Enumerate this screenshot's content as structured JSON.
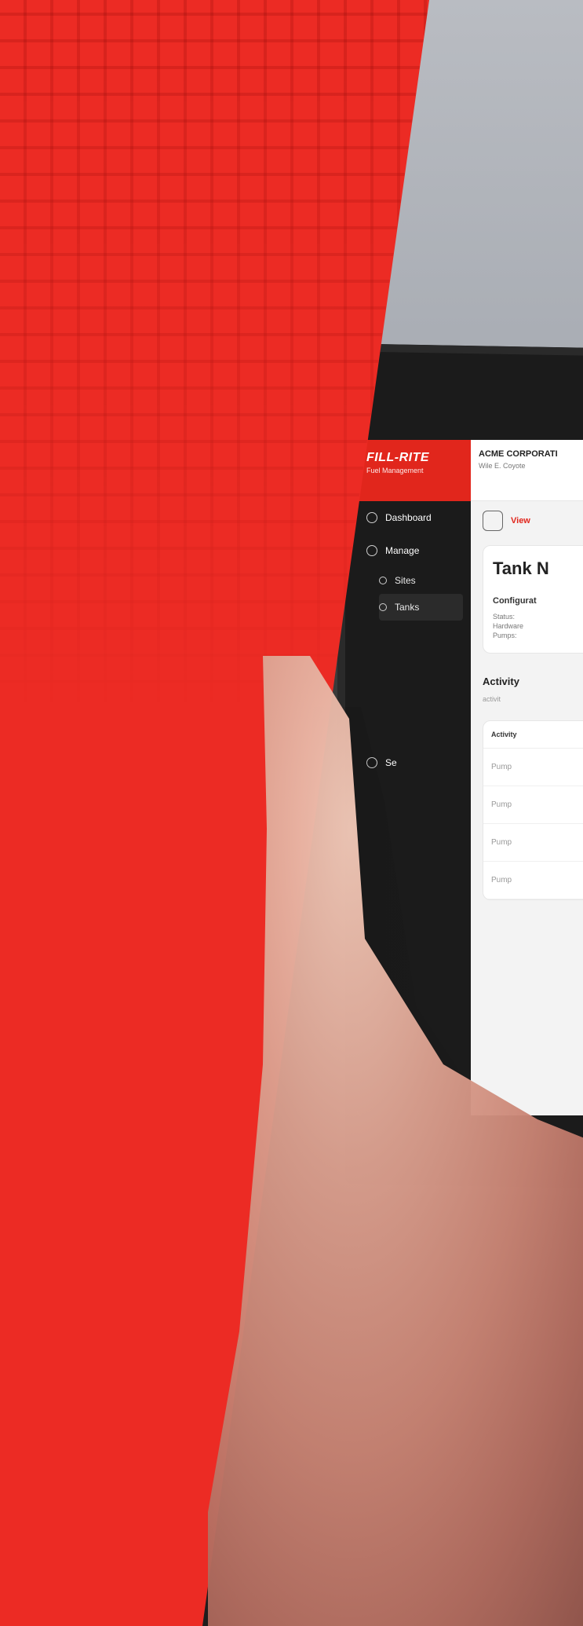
{
  "ui": {
    "brand": {
      "name": "FILL-RITE",
      "subtitle": "Fuel Management"
    },
    "org": {
      "name": "ACME CORPORATI",
      "user": "Wile E. Coyote"
    },
    "sidebar": {
      "dashboard": "Dashboard",
      "manage": "Manage",
      "sites": "Sites",
      "tanks": "Tanks",
      "settings_short": "Se"
    },
    "toolbar": {
      "view": "View"
    },
    "tank": {
      "title": "Tank N"
    },
    "config": {
      "title": "Configurat",
      "status": "Status:",
      "hardware": "Hardware",
      "pumps": "Pumps:"
    },
    "activity": {
      "title": "Activity",
      "subtitle": "activit",
      "column": "Activity",
      "rows": [
        "Pump",
        "Pump",
        "Pump",
        "Pump"
      ]
    }
  },
  "colors": {
    "accent_red": "#ec2b24",
    "sidebar_dark": "#1b1b1b"
  }
}
